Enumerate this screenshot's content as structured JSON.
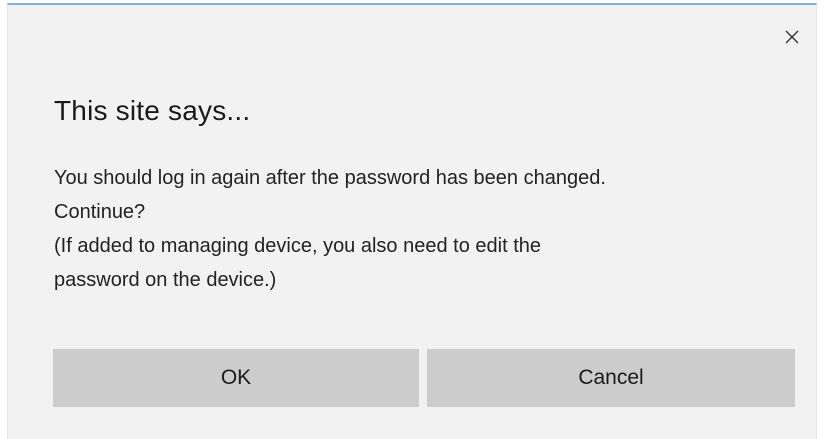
{
  "dialog": {
    "title": "This site says...",
    "message_lines": [
      "You should log in again after the password has been changed.",
      "Continue?",
      "(If added to managing device, you also need to edit the",
      "password on the device.)"
    ],
    "ok_label": "OK",
    "cancel_label": "Cancel",
    "close_icon": "close-icon"
  },
  "colors": {
    "dialog_background": "#f2f2f2",
    "button_background": "#cccccc",
    "top_border": "#7fb3e0"
  }
}
